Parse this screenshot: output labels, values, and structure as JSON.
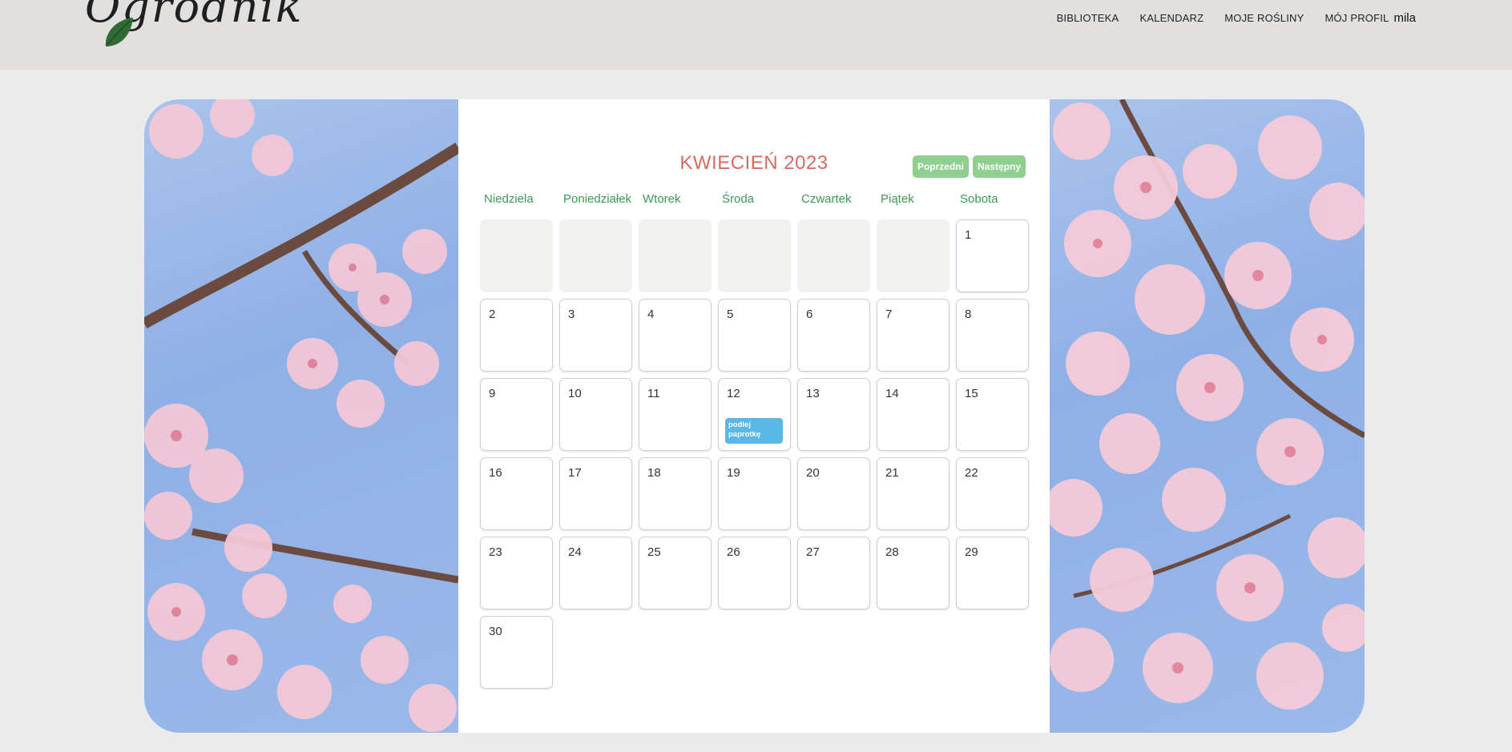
{
  "brand": {
    "name": "Ogrodnik"
  },
  "nav": {
    "items": [
      "BIBLIOTEKA",
      "KALENDARZ",
      "MOJE ROŚLINY",
      "MÓJ PROFIL"
    ],
    "username": "mila"
  },
  "calendar": {
    "title": "KWIECIEŃ 2023",
    "prev_label": "Poprzedni",
    "next_label": "Następny",
    "weekdays": [
      "Niedziela",
      "Poniedziałek",
      "Wtorek",
      "Środa",
      "Czwartek",
      "Piątek",
      "Sobota"
    ],
    "leading_empty_days": 6,
    "days_in_month": 30,
    "events": [
      {
        "day": 12,
        "text": "podlej paprotkę"
      }
    ]
  },
  "colors": {
    "title": "#d86a62",
    "weekday": "#3b9a54",
    "button": "#8fcf8f",
    "event": "#5bb8e6"
  }
}
